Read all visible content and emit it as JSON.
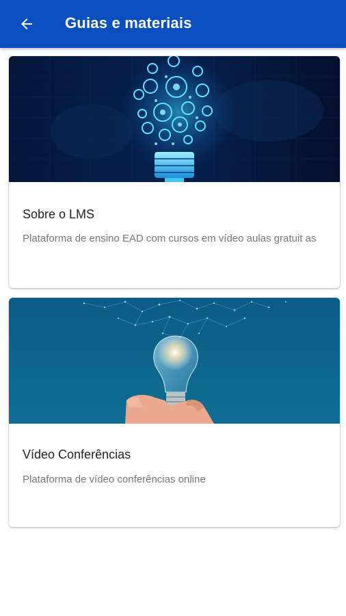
{
  "app_bar": {
    "title": "Guias e materiais",
    "back_icon": "arrow-left-icon",
    "color": "#0a4fc0"
  },
  "cards": [
    {
      "title": "Sobre o LMS",
      "description": "Plataforma de ensino EAD com cursos em vídeo aulas gratuit as",
      "image": "lightbulb-network-icons-image"
    },
    {
      "title": "Vídeo Conferências",
      "description": "Plataforma de vídeo conferências online",
      "image": "hand-holding-lightbulb-image"
    }
  ]
}
